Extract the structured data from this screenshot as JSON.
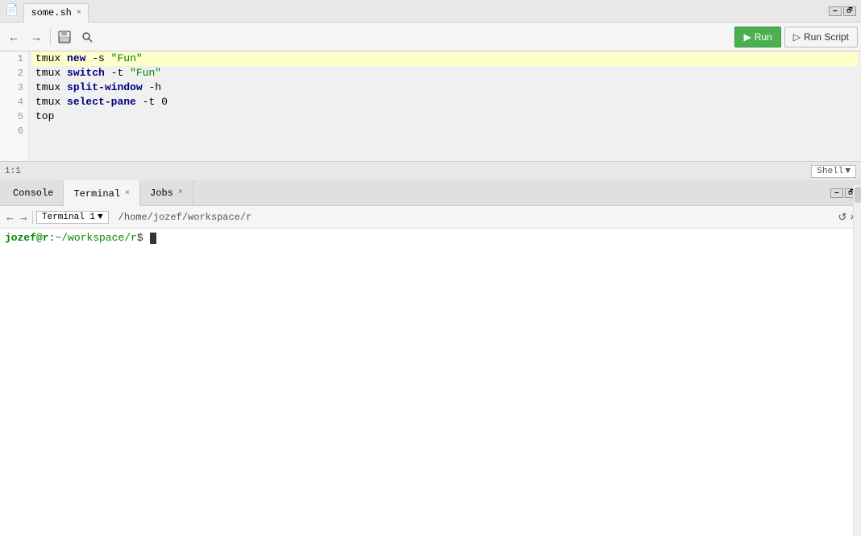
{
  "window": {
    "title": "some.sh",
    "tab_close": "×"
  },
  "toolbar": {
    "back_label": "←",
    "forward_label": "→",
    "save_label": "💾",
    "search_label": "🔍",
    "run_label": "Run",
    "run_script_label": "Run Script"
  },
  "editor": {
    "lines": [
      {
        "number": 1,
        "content": "tmux new -s \"Fun\"",
        "highlighted": true
      },
      {
        "number": 2,
        "content": "tmux switch -t \"Fun\"",
        "highlighted": false
      },
      {
        "number": 3,
        "content": "tmux split-window -h",
        "highlighted": false
      },
      {
        "number": 4,
        "content": "tmux select-pane -t 0",
        "highlighted": false
      },
      {
        "number": 5,
        "content": "top",
        "highlighted": false
      },
      {
        "number": 6,
        "content": "",
        "highlighted": false
      }
    ]
  },
  "status_bar": {
    "position": "1:1",
    "shell_label": "Shell",
    "shell_arrow": "▼"
  },
  "bottom_panel": {
    "tabs": [
      {
        "label": "Console",
        "closeable": false
      },
      {
        "label": "Terminal",
        "closeable": true
      },
      {
        "label": "Jobs",
        "closeable": true
      }
    ],
    "active_tab": "Terminal"
  },
  "terminal": {
    "session_label": "Terminal 1",
    "path": "/home/jozef/workspace/r",
    "prompt": "jozef@r:~/workspace/r$",
    "cursor_char": " "
  }
}
